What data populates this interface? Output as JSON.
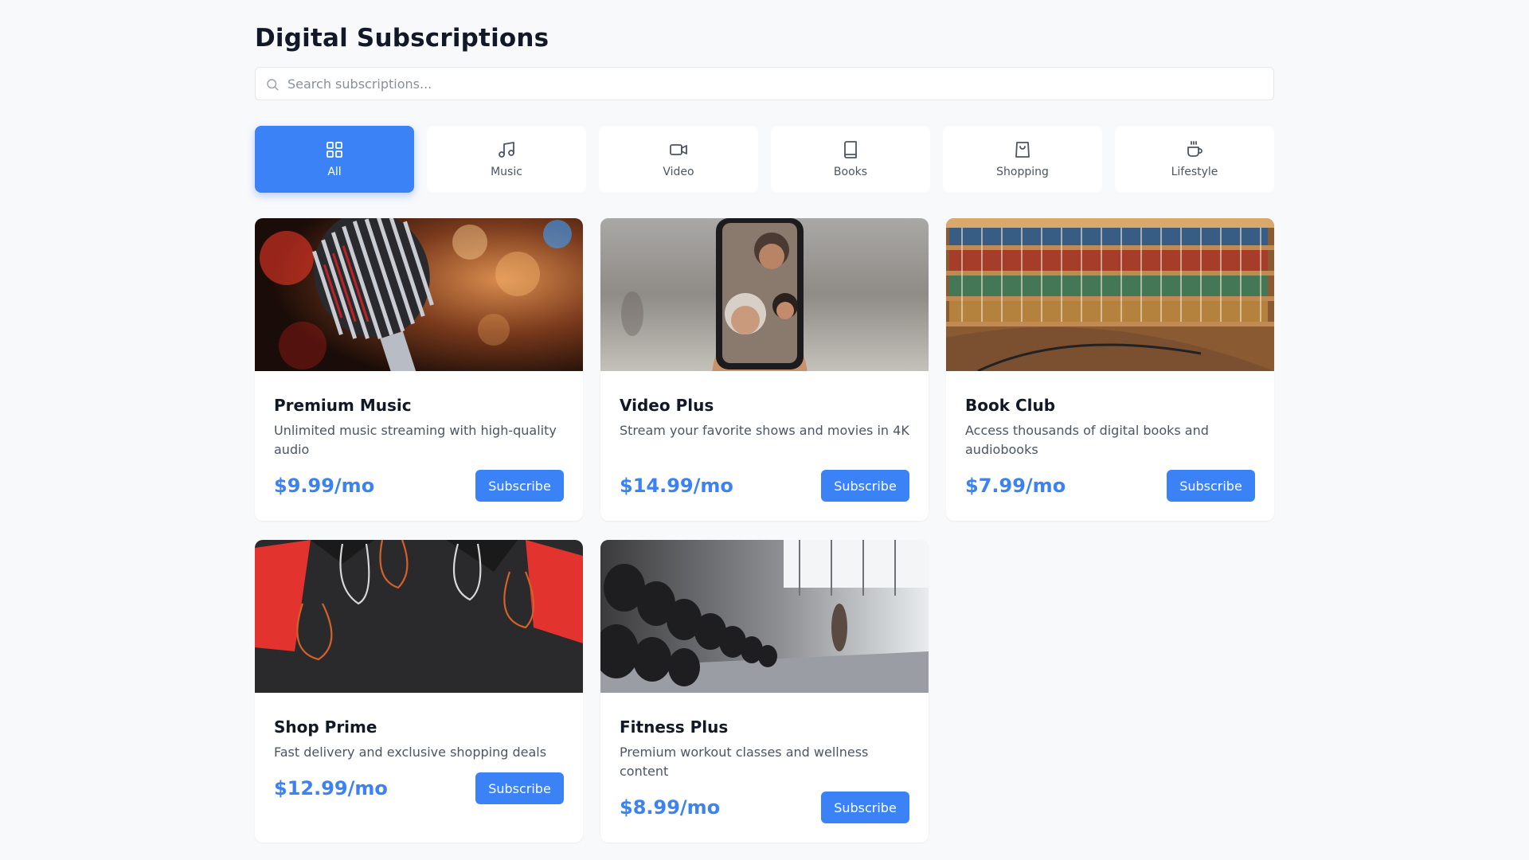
{
  "header": {
    "title": "Digital Subscriptions"
  },
  "search": {
    "placeholder": "Search subscriptions...",
    "value": ""
  },
  "categories": [
    {
      "label": "All",
      "icon": "grid-icon",
      "active": true
    },
    {
      "label": "Music",
      "icon": "music-note-icon",
      "active": false
    },
    {
      "label": "Video",
      "icon": "video-camera-icon",
      "active": false
    },
    {
      "label": "Books",
      "icon": "book-icon",
      "active": false
    },
    {
      "label": "Shopping",
      "icon": "shopping-bag-icon",
      "active": false
    },
    {
      "label": "Lifestyle",
      "icon": "coffee-cup-icon",
      "active": false
    }
  ],
  "subscriptions": [
    {
      "title": "Premium Music",
      "description": "Unlimited music streaming with high-quality audio",
      "price": "$9.99/mo",
      "button": "Subscribe",
      "image": "microphone-photo"
    },
    {
      "title": "Video Plus",
      "description": "Stream your favorite shows and movies in 4K",
      "price": "$14.99/mo",
      "button": "Subscribe",
      "image": "video-call-phone-photo"
    },
    {
      "title": "Book Club",
      "description": "Access thousands of digital books and audiobooks",
      "price": "$7.99/mo",
      "button": "Subscribe",
      "image": "library-bookshelf-photo"
    },
    {
      "title": "Shop Prime",
      "description": "Fast delivery and exclusive shopping deals",
      "price": "$12.99/mo",
      "button": "Subscribe",
      "image": "shopping-bags-photo"
    },
    {
      "title": "Fitness Plus",
      "description": "Premium workout classes and wellness content",
      "price": "$8.99/mo",
      "button": "Subscribe",
      "image": "gym-dumbbells-photo"
    }
  ],
  "colors": {
    "accent": "#3b82f6",
    "background": "#f8f9fb",
    "card": "#ffffff",
    "text": "#111827",
    "muted": "#4b5563"
  }
}
